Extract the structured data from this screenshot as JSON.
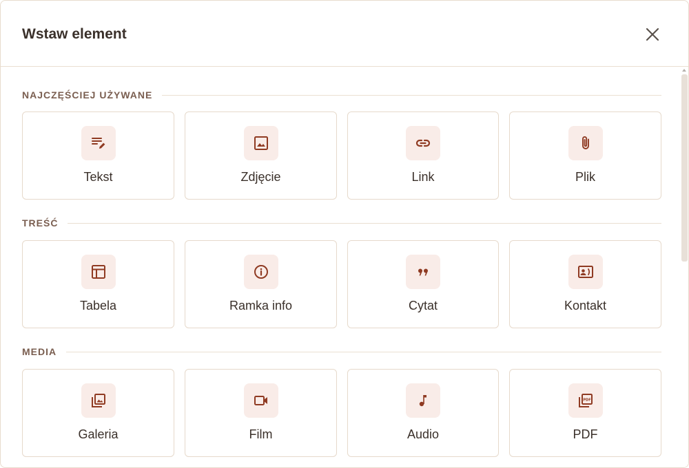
{
  "dialog": {
    "title": "Wstaw element",
    "close_icon": "close-icon"
  },
  "sections": [
    {
      "title": "NAJCZĘŚCIEJ UŻYWANE",
      "items": [
        {
          "label": "Tekst",
          "icon": "text-edit-icon"
        },
        {
          "label": "Zdjęcie",
          "icon": "image-icon"
        },
        {
          "label": "Link",
          "icon": "link-icon"
        },
        {
          "label": "Plik",
          "icon": "paperclip-icon"
        }
      ]
    },
    {
      "title": "TREŚĆ",
      "items": [
        {
          "label": "Tabela",
          "icon": "table-icon"
        },
        {
          "label": "Ramka info",
          "icon": "info-icon"
        },
        {
          "label": "Cytat",
          "icon": "quote-icon"
        },
        {
          "label": "Kontakt",
          "icon": "contact-card-icon"
        }
      ]
    },
    {
      "title": "MEDIA",
      "items": [
        {
          "label": "Galeria",
          "icon": "gallery-icon"
        },
        {
          "label": "Film",
          "icon": "video-camera-icon"
        },
        {
          "label": "Audio",
          "icon": "music-note-icon"
        },
        {
          "label": "PDF",
          "icon": "pdf-icon"
        }
      ]
    }
  ],
  "colors": {
    "accent_icon": "#8f3a22",
    "icon_background": "#f9ece8",
    "border": "#e6d9cb",
    "section_title": "#7a5e50",
    "text": "#3a302a"
  }
}
